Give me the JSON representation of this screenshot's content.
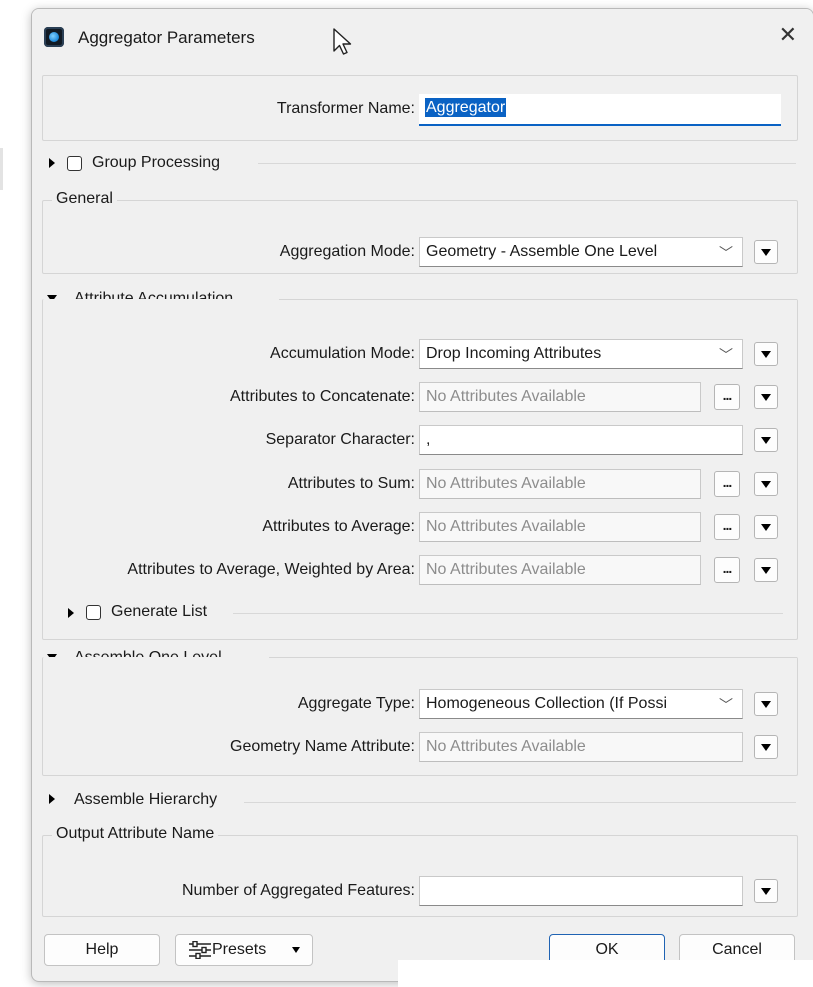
{
  "window": {
    "title": "Aggregator Parameters",
    "close_icon": "close-icon"
  },
  "transformer": {
    "label": "Transformer Name:",
    "value": "Aggregator"
  },
  "group_processing": {
    "label": "Group Processing",
    "checked": false
  },
  "general": {
    "title": "General",
    "aggregation_mode": {
      "label": "Aggregation Mode:",
      "value": "Geometry - Assemble One Level"
    }
  },
  "attribute_accumulation": {
    "title": "Attribute Accumulation",
    "accumulation_mode": {
      "label": "Accumulation Mode:",
      "value": "Drop Incoming Attributes"
    },
    "concatenate": {
      "label": "Attributes to Concatenate:",
      "value": "No Attributes Available"
    },
    "separator": {
      "label": "Separator Character:",
      "value": ","
    },
    "sum": {
      "label": "Attributes to Sum:",
      "value": "No Attributes Available"
    },
    "average": {
      "label": "Attributes to Average:",
      "value": "No Attributes Available"
    },
    "weighted": {
      "label": "Attributes to Average, Weighted by Area:",
      "value": "No Attributes Available"
    },
    "generate_list": {
      "label": "Generate List",
      "checked": false
    },
    "dots_label": "..."
  },
  "assemble_one_level": {
    "title": "Assemble One Level",
    "aggregate_type": {
      "label": "Aggregate Type:",
      "value": "Homogeneous Collection (If Possi"
    },
    "geometry_name": {
      "label": "Geometry Name Attribute:",
      "value": "No Attributes Available"
    }
  },
  "assemble_hierarchy": {
    "title": "Assemble Hierarchy"
  },
  "output_attribute": {
    "title": "Output Attribute Name",
    "aggregated_features": {
      "label": "Number of Aggregated Features:",
      "value": ""
    }
  },
  "footer": {
    "help": "Help",
    "presets": "Presets",
    "ok": "OK",
    "cancel": "Cancel"
  },
  "colors": {
    "accent": "#0a62c4",
    "dialog_bg": "#f0f0f0"
  }
}
